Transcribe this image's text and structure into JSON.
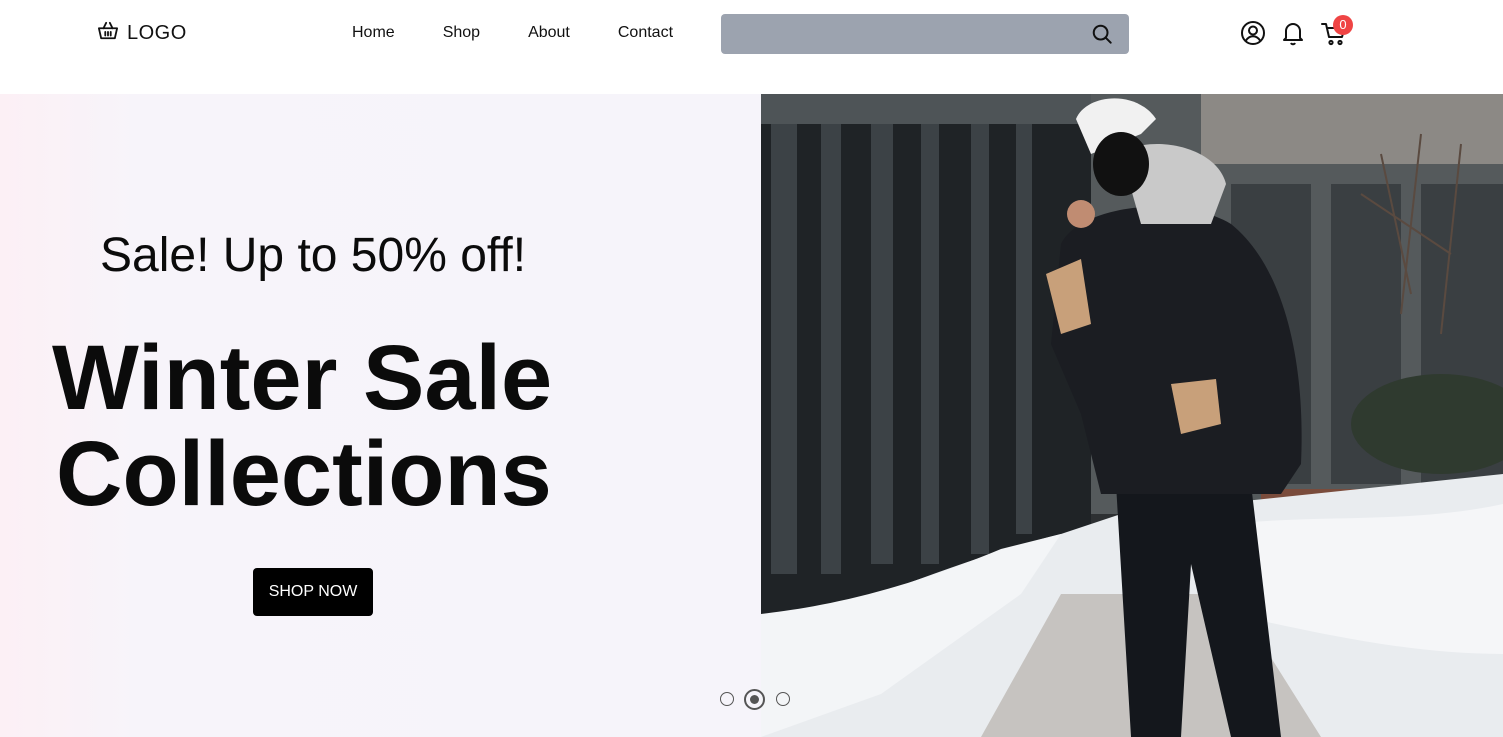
{
  "header": {
    "logo_text": "LOGO",
    "nav": [
      {
        "label": "Home"
      },
      {
        "label": "Shop"
      },
      {
        "label": "About"
      },
      {
        "label": "Contact"
      }
    ],
    "search": {
      "placeholder": "",
      "value": "",
      "bg_color": "#9ca3af"
    },
    "icons": [
      "user-icon",
      "bell-icon",
      "cart-icon"
    ],
    "cart_count": "0",
    "badge_color": "#ef4444"
  },
  "hero": {
    "subtitle": "Sale! Up to 50% off!",
    "title_line1": "Winter Sale",
    "title_line2": "Collections",
    "cta_label": "SHOP NOW",
    "slides": {
      "count": 3,
      "active": 2
    }
  }
}
